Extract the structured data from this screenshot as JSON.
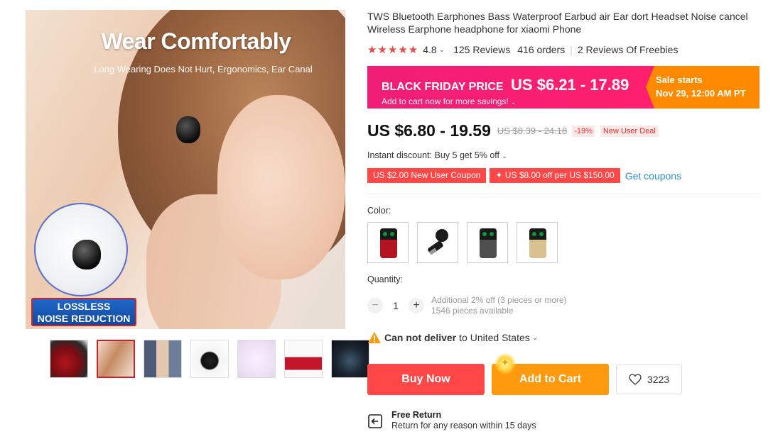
{
  "gallery": {
    "headline": "Wear Comfortably",
    "subline": "Long Wearing Does Not Hurt, Ergonomics, Ear Canal",
    "badge_line1": "LOSSLESS",
    "badge_line2": "NOISE REDUCTION",
    "thumbnails": [
      {
        "name": "thumb-red-case",
        "active": false
      },
      {
        "name": "thumb-wear-comfortably",
        "active": true
      },
      {
        "name": "thumb-collage",
        "active": false
      },
      {
        "name": "thumb-earbud-closeup",
        "active": false
      },
      {
        "name": "thumb-features",
        "active": false
      },
      {
        "name": "thumb-cases",
        "active": false
      },
      {
        "name": "thumb-dark-case",
        "active": false
      }
    ]
  },
  "product": {
    "title": "TWS Bluetooth Earphones Bass Waterproof Earbud air Ear dort Headset Noise cancel Wireless Earphone headphone for xiaomi Phone",
    "rating": "4.8",
    "reviews": "125 Reviews",
    "orders": "416 orders",
    "freebie_reviews": "2 Reviews Of Freebies"
  },
  "black_friday": {
    "label": "BLACK FRIDAY PRICE",
    "price": "US $6.21 - 17.89",
    "sub": "Add to cart now for more savings!",
    "sale_starts": "Sale starts",
    "sale_date": "Nov 29, 12:00 AM PT"
  },
  "pricing": {
    "current": "US $6.80 - 19.59",
    "original": "US $8.39 - 24.18",
    "discount": "-19%",
    "new_user_deal": "New User Deal"
  },
  "promotions": {
    "instant_discount": "Instant discount: Buy 5 get 5% off",
    "coupon1": "US $2.00 New User Coupon",
    "coupon2": "✦ US $8.00 off per US $150.00",
    "get_coupons": "Get coupons"
  },
  "options": {
    "color_label": "Color:",
    "quantity_label": "Quantity:",
    "quantity_value": "1",
    "additional_off": "Additional 2% off (3 pieces or more)",
    "available": "1546 pieces available"
  },
  "delivery": {
    "status": "Can not deliver",
    "to": "to United States"
  },
  "actions": {
    "buy_now": "Buy Now",
    "add_to_cart": "Add to Cart",
    "wishlist_count": "3223"
  },
  "free_return": {
    "title": "Free Return",
    "sub": "Return for any reason within 15 days"
  },
  "colors": {
    "accent_red": "#ff4747",
    "accent_orange": "#ff9a0e",
    "bf_pink": "#f01e77",
    "link_blue": "#2d8fd5",
    "star_red": "#e84b4b"
  }
}
